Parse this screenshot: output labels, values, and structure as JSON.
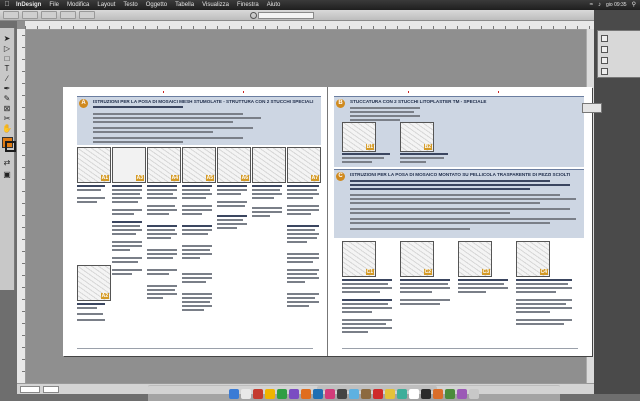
{
  "menubar": {
    "app": "InDesign",
    "items": [
      "File",
      "Modifica",
      "Layout",
      "Testo",
      "Oggetto",
      "Tabella",
      "Visualizza",
      "Finestra",
      "Aiuto"
    ],
    "time": "gio 09:35"
  },
  "control_bar": {
    "document_field": ""
  },
  "status": {
    "zoom": "",
    "page": ""
  },
  "spread": {
    "left": {
      "section_letter": "A",
      "section_title": "ISTRUZIONI PER LA POSA DI MOSAICI MESH STUMOLATE - STRUTTURA CON 2 STUCCHI SPECIALI",
      "figure_labels": [
        "A1",
        "A2",
        "A3",
        "A4",
        "A5",
        "A6",
        "A7"
      ]
    },
    "right": {
      "section_b_letter": "B",
      "section_b_title": "STUCCATURA CON 2 STUCCHI LITOPLASTER TM - SPECIALE",
      "section_c_letter": "C",
      "section_c_title": "ISTRUZIONI PER LA POSA DI MOSAICO MONTATO SU PELLICOLA TRASPARENTE DI PEZZI SCIOLTI",
      "figure_labels_b": [
        "B1",
        "B2"
      ],
      "figure_labels_c": [
        "C1",
        "C2",
        "C3",
        "C4"
      ]
    }
  },
  "colors": {
    "accent": "#d08a1f",
    "banner": "#cdd6e3",
    "fill_swatch": "#e07b12"
  }
}
